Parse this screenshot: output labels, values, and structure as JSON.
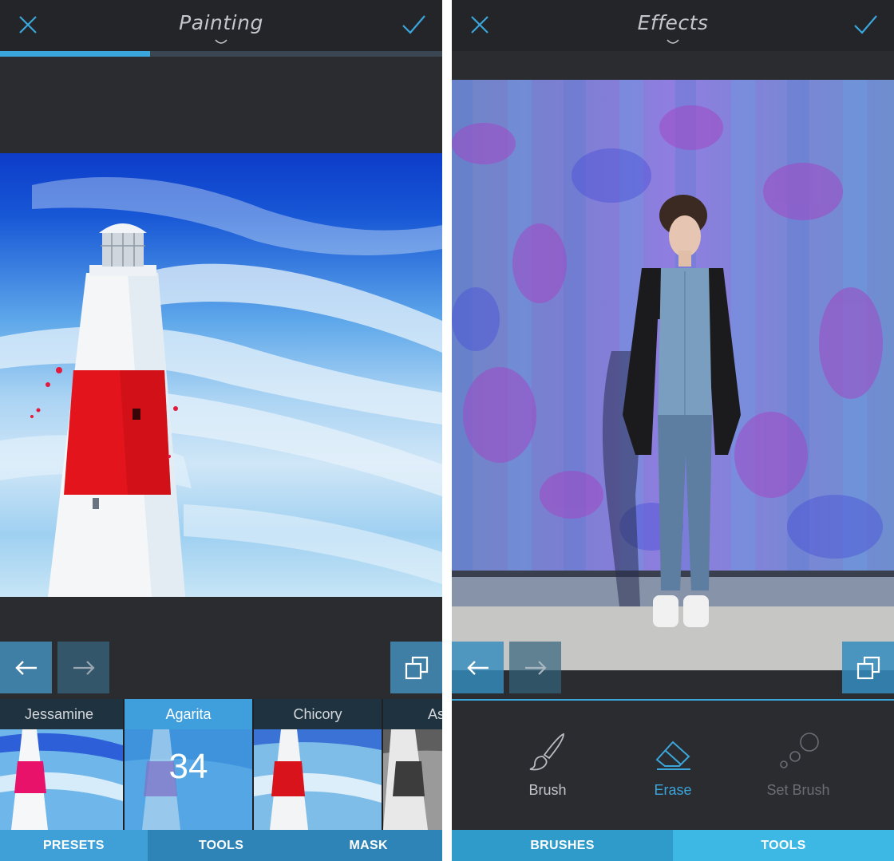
{
  "left_screen": {
    "title": "Painting",
    "progress_percent": 34,
    "presets": [
      {
        "label": "Jessamine"
      },
      {
        "label": "Agarita",
        "value": "34"
      },
      {
        "label": "Chicory"
      },
      {
        "label": "As"
      }
    ],
    "tabs": [
      "PRESETS",
      "TOOLS",
      "MASK"
    ]
  },
  "right_screen": {
    "title": "Effects",
    "tools": [
      {
        "label": "Brush",
        "icon": "brush-icon"
      },
      {
        "label": "Erase",
        "icon": "eraser-icon"
      },
      {
        "label": "Set Brush",
        "icon": "brush-size-icon"
      }
    ],
    "tabs": [
      "BRUSHES",
      "TOOLS"
    ]
  },
  "colors": {
    "accent": "#3aa6dc",
    "background": "#2b2c30",
    "header": "#242529",
    "tab_active": "#3fa0d8",
    "tab_inactive": "#2e84b6"
  }
}
